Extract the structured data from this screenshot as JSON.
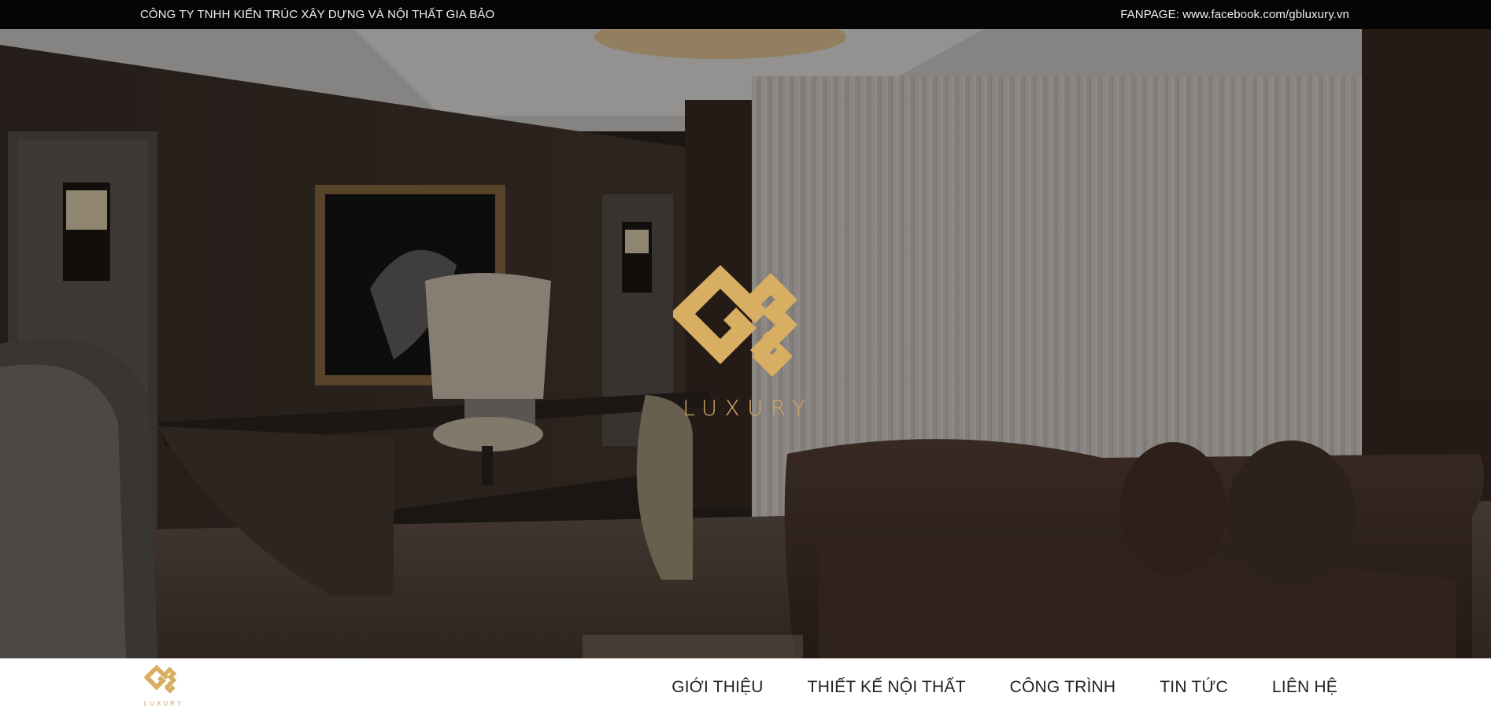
{
  "topbar": {
    "company": "CÔNG TY TNHH KIẾN TRÚC XÂY DỰNG VÀ NỘI THẤT GIA BẢO",
    "fanpage": "FANPAGE: www.facebook.com/gbluxury.vn"
  },
  "hero": {
    "image": "luxury-study-room-interior",
    "logo_text": "LUXURY",
    "brand_color": "#d8ae62"
  },
  "nav": {
    "logo_text": "LUXURY",
    "items": [
      {
        "label": "GIỚI THIỆU"
      },
      {
        "label": "THIẾT KẾ NỘI THẤT"
      },
      {
        "label": "CÔNG TRÌNH"
      },
      {
        "label": "TIN TỨC"
      },
      {
        "label": "LIÊN HỆ"
      }
    ]
  }
}
